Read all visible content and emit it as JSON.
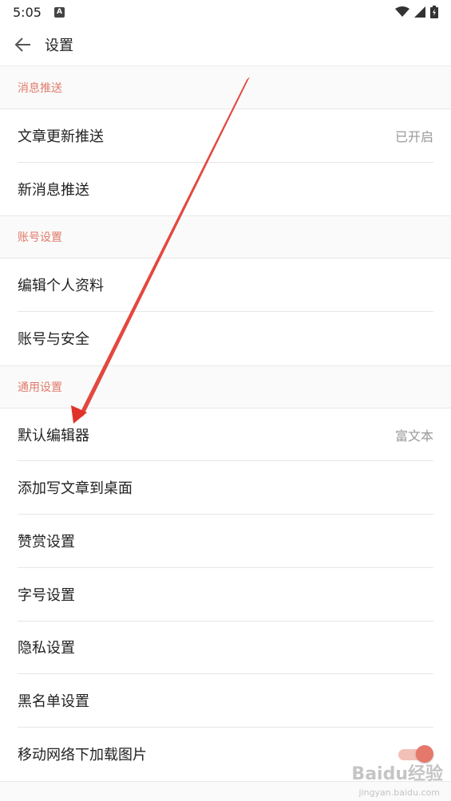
{
  "status_bar": {
    "time": "5:05",
    "notification_icon": "A"
  },
  "app_bar": {
    "title": "设置"
  },
  "sections": [
    {
      "header": "消息推送",
      "items": [
        {
          "label": "文章更新推送",
          "value": "已开启"
        },
        {
          "label": "新消息推送"
        }
      ]
    },
    {
      "header": "账号设置",
      "items": [
        {
          "label": "编辑个人资料"
        },
        {
          "label": "账号与安全"
        }
      ]
    },
    {
      "header": "通用设置",
      "items": [
        {
          "label": "默认编辑器",
          "value": "富文本"
        },
        {
          "label": "添加写文章到桌面"
        },
        {
          "label": "赞赏设置"
        },
        {
          "label": "字号设置"
        },
        {
          "label": "隐私设置"
        },
        {
          "label": "黑名单设置"
        },
        {
          "label": "移动网络下加载图片",
          "toggle_on": true
        }
      ]
    }
  ],
  "watermark": {
    "brand": "Baidu经验",
    "url": "jingyan.baidu.com"
  },
  "colors": {
    "accent": "#e5786a",
    "section_text": "#e07b6a",
    "arrow": "#e0342a"
  }
}
